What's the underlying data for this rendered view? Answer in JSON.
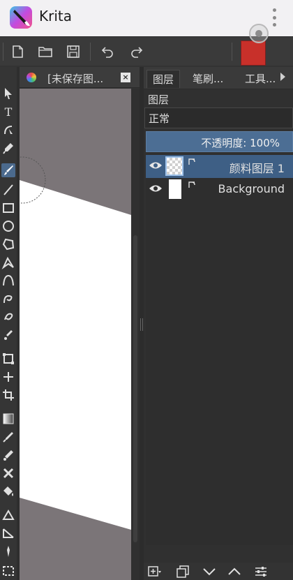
{
  "app": {
    "title": "Krita"
  },
  "document": {
    "tab_title": "[未保存图...",
    "close_label": "×"
  },
  "toolbar": {
    "buttons": [
      "new-document-icon",
      "open-document-icon",
      "save-icon",
      "undo-icon",
      "redo-icon"
    ],
    "foreground_color": "#c8302a"
  },
  "tools": [
    "select-shapes",
    "text",
    "edit-shapes",
    "calligraphy",
    "freehand-brush",
    "line",
    "rectangle",
    "ellipse",
    "polygon",
    "polyline",
    "bezier-curve",
    "freehand-path",
    "dynamic-brush",
    "multibrush",
    "transform",
    "move",
    "crop",
    "gradient",
    "color-picker",
    "smart-patch",
    "fill",
    "enclose-and-fill",
    "assistant",
    "measure",
    "reference-images",
    "rectangular-selection"
  ],
  "docker": {
    "tabs": [
      {
        "label": "图层",
        "active": true
      },
      {
        "label": "笔刷...",
        "active": false
      },
      {
        "label": "工具...",
        "active": false
      }
    ]
  },
  "layers_panel": {
    "title": "图层",
    "blend_mode": "正常",
    "opacity_label": "不透明度:  100%",
    "layers": [
      {
        "name": "颜料图层 1",
        "visible": true,
        "selected": true,
        "thumb": "checker"
      },
      {
        "name": "Background",
        "visible": true,
        "selected": false,
        "thumb": "white"
      }
    ]
  },
  "canvas": {
    "background_color": "#7b7578",
    "paper_color": "#ffffff"
  }
}
